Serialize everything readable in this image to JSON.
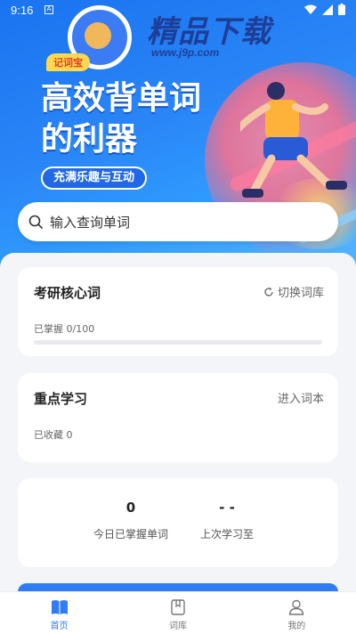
{
  "status_bar": {
    "time": "9:16",
    "sim_label": "A"
  },
  "watermark": {
    "title": "精品下载",
    "url": "www.j9p.com"
  },
  "hero": {
    "tag": "记词宝",
    "headline_line1": "高效背单词",
    "headline_line2": "的利器",
    "pill": "充满乐趣与互动"
  },
  "search": {
    "placeholder": "输入查询单词",
    "icon": "search-icon"
  },
  "vocab_card": {
    "title": "考研核心词",
    "action_label": "切换词库",
    "action_icon": "refresh-icon",
    "mastered_text": "已掌握 0/100",
    "mastered": 0,
    "total": 100
  },
  "focus_card": {
    "title": "重点学习",
    "action_label": "进入词本",
    "favorites_text": "已收藏 0"
  },
  "stats_card": {
    "today_value": "0",
    "today_label": "今日已掌握单词",
    "last_value": "- -",
    "last_label": "上次学习至"
  },
  "nav": {
    "items": [
      {
        "label": "首页",
        "icon": "book-open-icon",
        "active": true
      },
      {
        "label": "词库",
        "icon": "bookmark-book-icon",
        "active": false
      },
      {
        "label": "我的",
        "icon": "person-icon",
        "active": false
      }
    ]
  },
  "colors": {
    "accent": "#2f7cf6",
    "hero_blue": "#1a73f0",
    "tag_yellow": "#ffd84d"
  }
}
